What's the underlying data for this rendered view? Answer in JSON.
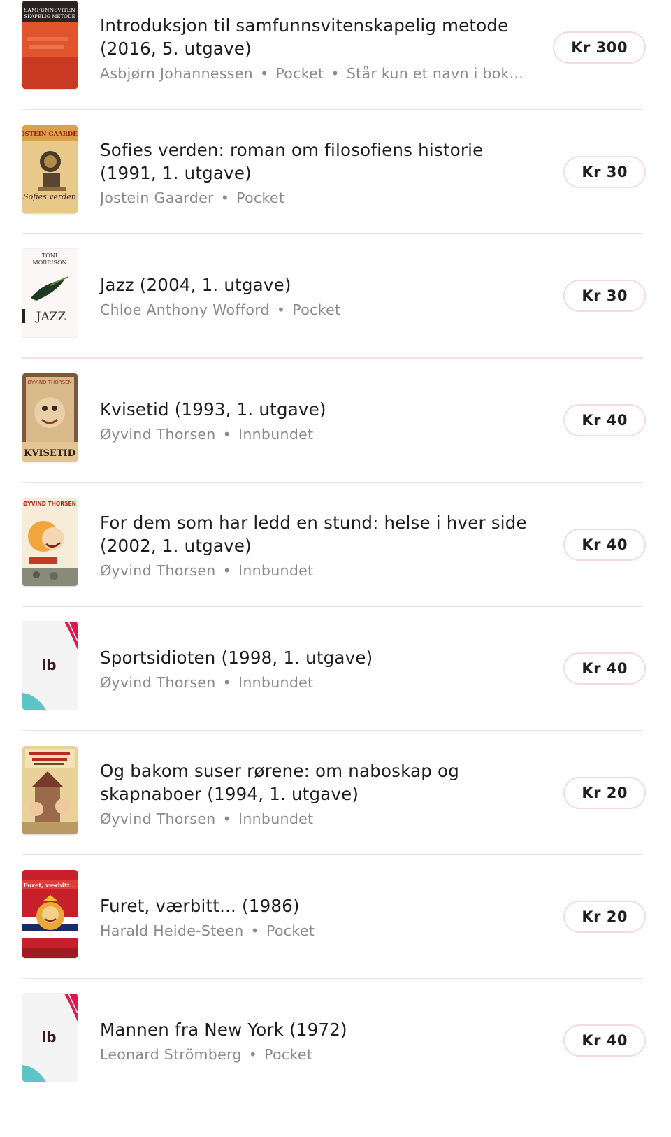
{
  "books": [
    {
      "title": "Introduksjon til samfunnsvitenskapelig metode (2016, 5. utgave)",
      "author": "Asbjørn Johannessen",
      "format": "Pocket",
      "note": "Står kun et navn i bok...",
      "price": "Kr 300",
      "cover": "samfunnsvitenskapelig-metode-cover",
      "cover_texts": [
        "SAMFUNNSVITEN",
        "SKAPELIG METODE"
      ]
    },
    {
      "title": "Sofies verden: roman om filosofiens historie (1991, 1. utgave)",
      "author": "Jostein Gaarder",
      "format": "Pocket",
      "price": "Kr 30",
      "cover": "sofies-verden-cover",
      "cover_texts": [
        "JOSTEIN GAARDER",
        "Sofies verden"
      ]
    },
    {
      "title": "Jazz (2004, 1. utgave)",
      "author": "Chloe Anthony Wofford",
      "format": "Pocket",
      "price": "Kr 30",
      "cover": "jazz-cover",
      "cover_texts": [
        "TONI",
        "MORRISON",
        "JAZZ"
      ]
    },
    {
      "title": "Kvisetid (1993, 1. utgave)",
      "author": "Øyvind Thorsen",
      "format": "Innbundet",
      "price": "Kr 40",
      "cover": "kvisetid-cover",
      "cover_texts": [
        "ØYVIND THORSEN",
        "KVISETID"
      ]
    },
    {
      "title": "For dem som har ledd en stund: helse i hver side (2002, 1. utgave)",
      "author": "Øyvind Thorsen",
      "format": "Innbundet",
      "price": "Kr 40",
      "cover": "for-dem-som-har-ledd-cover",
      "cover_texts": [
        "ØYVIND THORSEN"
      ]
    },
    {
      "title": "Sportsidioten (1998, 1. utgave)",
      "author": "Øyvind Thorsen",
      "format": "Innbundet",
      "price": "Kr 40",
      "cover": "placeholder-logo-cover",
      "cover_texts": [
        "lb"
      ]
    },
    {
      "title": "Og bakom suser rørene: om naboskap og skapnaboer (1994, 1. utgave)",
      "author": "Øyvind Thorsen",
      "format": "Innbundet",
      "price": "Kr 20",
      "cover": "og-bakom-suser-rorene-cover",
      "cover_texts": []
    },
    {
      "title": "Furet, værbitt... (1986)",
      "author": "Harald Heide-Steen",
      "format": "Pocket",
      "price": "Kr 20",
      "cover": "furet-verbitt-cover",
      "cover_texts": [
        "Furet, værbitt..."
      ]
    },
    {
      "title": "Mannen fra New York (1972)",
      "author": "Leonard Strömberg",
      "format": "Pocket",
      "price": "Kr 40",
      "cover": "placeholder-logo-cover",
      "cover_texts": [
        "lb"
      ]
    }
  ],
  "colors": {
    "divider": "#f6dfe3",
    "price_border": "#f5dbe0",
    "meta_text": "#8a8a8a",
    "logo_red": "#d81b4e",
    "logo_teal": "#5cc5c8"
  }
}
